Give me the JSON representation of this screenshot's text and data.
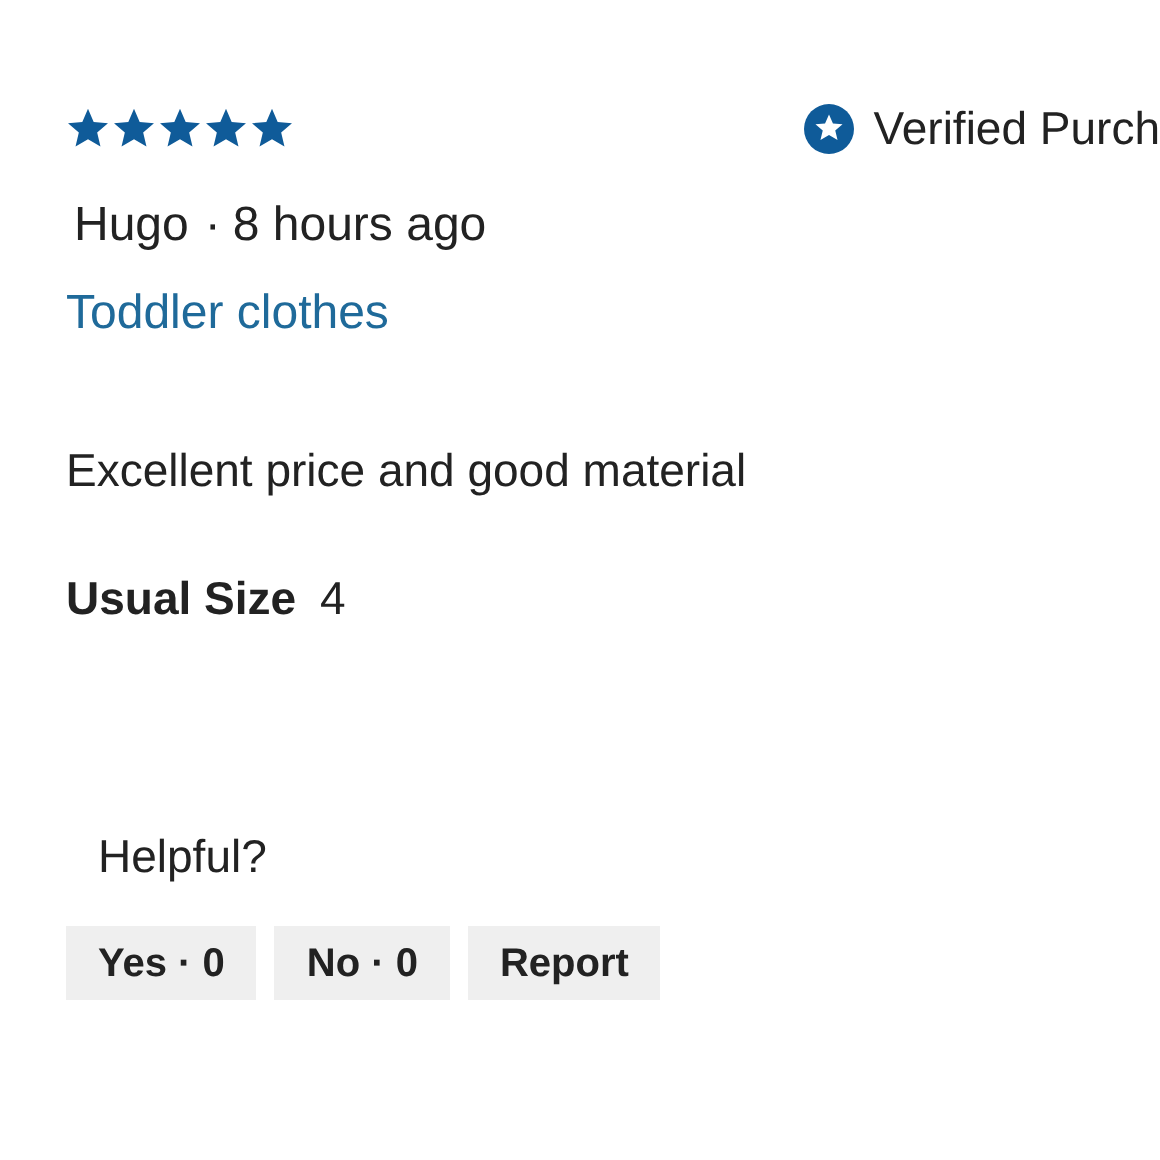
{
  "review": {
    "stars": 5,
    "verified": "Verified Purch",
    "author": "Hugo",
    "separator": "·",
    "time": "8 hours ago",
    "title": "Toddler clothes",
    "body": "Excellent price and good material",
    "attributes": [
      {
        "label": "Usual Size",
        "value": "4"
      }
    ]
  },
  "helpful": {
    "label": "Helpful?",
    "buttons": [
      "Yes · 0",
      "No · 0",
      "Report"
    ]
  }
}
